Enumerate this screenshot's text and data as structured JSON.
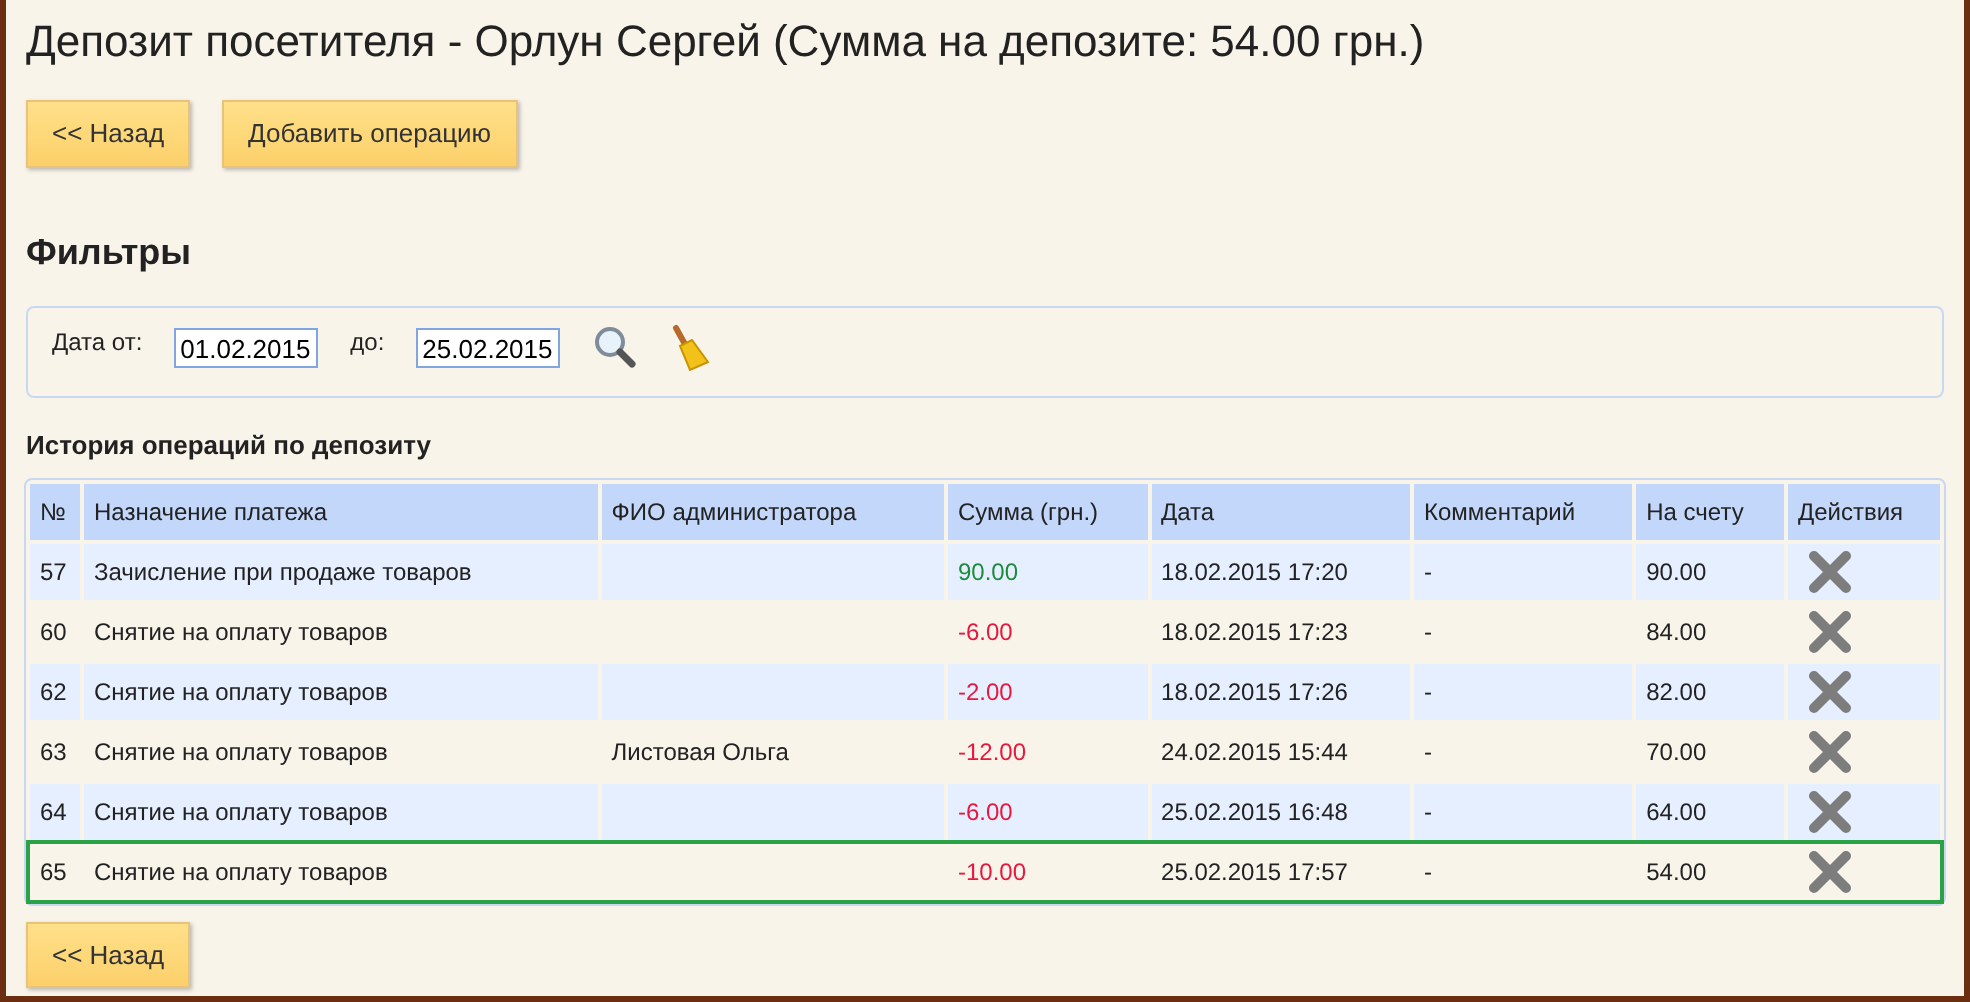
{
  "title": "Депозит посетителя - Орлун Сергей (Сумма на депозите: 54.00 грн.)",
  "top_buttons": [
    "<< Назад",
    "Добавить операцию"
  ],
  "filters": {
    "heading": "Фильтры",
    "from_label": "Дата от:",
    "from_value": "01.02.2015",
    "to_label": "до:",
    "to_value": "25.02.2015"
  },
  "history": {
    "heading": "История операций по депозиту",
    "columns": [
      "№",
      "Назначение платежа",
      "ФИО администратора",
      "Сумма (грн.)",
      "Дата",
      "Комментарий",
      "На счету",
      "Действия"
    ],
    "rows": [
      {
        "number": "57",
        "purpose": "Зачисление при продаже товаров",
        "amount": "90.00",
        "kind": "credit",
        "date": "18.02.2015 17:20",
        "comment": "-",
        "balance": "90.00",
        "highlighted": false
      },
      {
        "number": "60",
        "purpose": "Снятие на оплату товаров",
        "amount": "-6.00",
        "kind": "debit",
        "date": "18.02.2015 17:23",
        "comment": "-",
        "balance": "84.00",
        "highlighted": false
      },
      {
        "number": "62",
        "purpose": "Снятие на оплату товаров",
        "amount": "-2.00",
        "kind": "debit",
        "date": "18.02.2015 17:26",
        "comment": "-",
        "balance": "82.00",
        "highlighted": false
      },
      {
        "number": "63",
        "purpose": "Снятие на оплату товаров",
        "admin": "Листовая Ольга",
        "amount": "-12.00",
        "kind": "debit",
        "date": "24.02.2015 15:44",
        "comment": "-",
        "balance": "70.00",
        "highlighted": false
      },
      {
        "number": "64",
        "purpose": "Снятие на оплату товаров",
        "amount": "-6.00",
        "kind": "debit",
        "date": "25.02.2015 16:48",
        "comment": "-",
        "balance": "64.00",
        "highlighted": false
      },
      {
        "number": "65",
        "purpose": "Снятие на оплату товаров",
        "amount": "-10.00",
        "kind": "debit",
        "date": "25.02.2015 17:57",
        "comment": "-",
        "balance": "54.00",
        "highlighted": true
      }
    ]
  },
  "bottom_button": "<< Назад"
}
